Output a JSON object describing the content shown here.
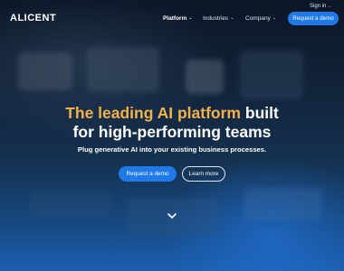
{
  "nav": {
    "logo": "ALICENT",
    "items": [
      {
        "label": "Platform",
        "active": true
      },
      {
        "label": "Industries",
        "active": false
      },
      {
        "label": "Company",
        "active": false
      }
    ],
    "signin_label": "Sign in",
    "cta_label": "Request a demo"
  },
  "hero": {
    "title_highlight": "The leading AI platform",
    "title_rest_line1": "built",
    "title_line2": "for high-performing teams",
    "subtitle": "Plug generative AI into your existing business processes.",
    "primary_button": "Request a demo",
    "secondary_button": "Learn more"
  },
  "icons": {
    "nav_chevron": "chevron-down-icon",
    "signin_arrow": "arrow-right-icon",
    "scroll": "chevron-down-icon"
  },
  "colors": {
    "accent_blue": "#1f7ae8",
    "highlight_orange": "#f2b24a",
    "text_white": "#ffffff"
  }
}
